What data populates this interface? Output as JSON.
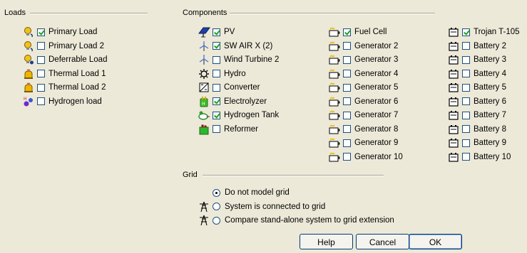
{
  "groups": {
    "loads": "Loads",
    "components": "Components",
    "grid": "Grid"
  },
  "loads": [
    {
      "label": "Primary Load",
      "checked": true,
      "icon": "primary-load-icon"
    },
    {
      "label": "Primary Load 2",
      "checked": false,
      "icon": "primary-load-icon"
    },
    {
      "label": "Deferrable Load",
      "checked": false,
      "icon": "deferrable-load-icon"
    },
    {
      "label": "Thermal Load 1",
      "checked": false,
      "icon": "thermal-load-icon"
    },
    {
      "label": "Thermal Load 2",
      "checked": false,
      "icon": "thermal-load-icon"
    },
    {
      "label": "Hydrogen load",
      "checked": false,
      "icon": "hydrogen-load-icon"
    }
  ],
  "components_col1": [
    {
      "label": "PV",
      "checked": true,
      "icon": "pv-panel-icon"
    },
    {
      "label": "SW AIR X (2)",
      "checked": true,
      "icon": "wind-turbine-icon"
    },
    {
      "label": "Wind Turbine 2",
      "checked": false,
      "icon": "wind-turbine-icon"
    },
    {
      "label": "Hydro",
      "checked": false,
      "icon": "hydro-icon"
    },
    {
      "label": "Converter",
      "checked": false,
      "icon": "converter-icon"
    },
    {
      "label": "Electrolyzer",
      "checked": true,
      "icon": "electrolyzer-icon"
    },
    {
      "label": "Hydrogen Tank",
      "checked": true,
      "icon": "hydrogen-tank-icon"
    },
    {
      "label": "Reformer",
      "checked": false,
      "icon": "reformer-icon"
    }
  ],
  "components_col2": [
    {
      "label": "Fuel Cell",
      "checked": true,
      "icon": "generator-icon"
    },
    {
      "label": "Generator 2",
      "checked": false,
      "icon": "generator-icon"
    },
    {
      "label": "Generator 3",
      "checked": false,
      "icon": "generator-icon"
    },
    {
      "label": "Generator 4",
      "checked": false,
      "icon": "generator-icon"
    },
    {
      "label": "Generator 5",
      "checked": false,
      "icon": "generator-icon"
    },
    {
      "label": "Generator 6",
      "checked": false,
      "icon": "generator-icon"
    },
    {
      "label": "Generator 7",
      "checked": false,
      "icon": "generator-icon"
    },
    {
      "label": "Generator 8",
      "checked": false,
      "icon": "generator-icon"
    },
    {
      "label": "Generator 9",
      "checked": false,
      "icon": "generator-icon"
    },
    {
      "label": "Generator 10",
      "checked": false,
      "icon": "generator-icon"
    }
  ],
  "components_col3": [
    {
      "label": "Trojan T-105",
      "checked": true,
      "icon": "battery-icon"
    },
    {
      "label": "Battery 2",
      "checked": false,
      "icon": "battery-icon"
    },
    {
      "label": "Battery 3",
      "checked": false,
      "icon": "battery-icon"
    },
    {
      "label": "Battery 4",
      "checked": false,
      "icon": "battery-icon"
    },
    {
      "label": "Battery 5",
      "checked": false,
      "icon": "battery-icon"
    },
    {
      "label": "Battery 6",
      "checked": false,
      "icon": "battery-icon"
    },
    {
      "label": "Battery 7",
      "checked": false,
      "icon": "battery-icon"
    },
    {
      "label": "Battery 8",
      "checked": false,
      "icon": "battery-icon"
    },
    {
      "label": "Battery 9",
      "checked": false,
      "icon": "battery-icon"
    },
    {
      "label": "Battery 10",
      "checked": false,
      "icon": "battery-icon"
    }
  ],
  "grid_options": [
    {
      "label": "Do not model grid",
      "selected": true,
      "icon": null
    },
    {
      "label": "System is connected to grid",
      "selected": false,
      "icon": "grid-tower-icon"
    },
    {
      "label": "Compare stand-alone system to grid extension",
      "selected": false,
      "icon": "grid-tower-icon"
    }
  ],
  "buttons": {
    "help": "Help",
    "cancel": "Cancel",
    "ok": "OK"
  },
  "colors": {
    "dialog_bg": "#ece9d8",
    "check_mark": "#21a121",
    "control_border": "#1c5180"
  }
}
